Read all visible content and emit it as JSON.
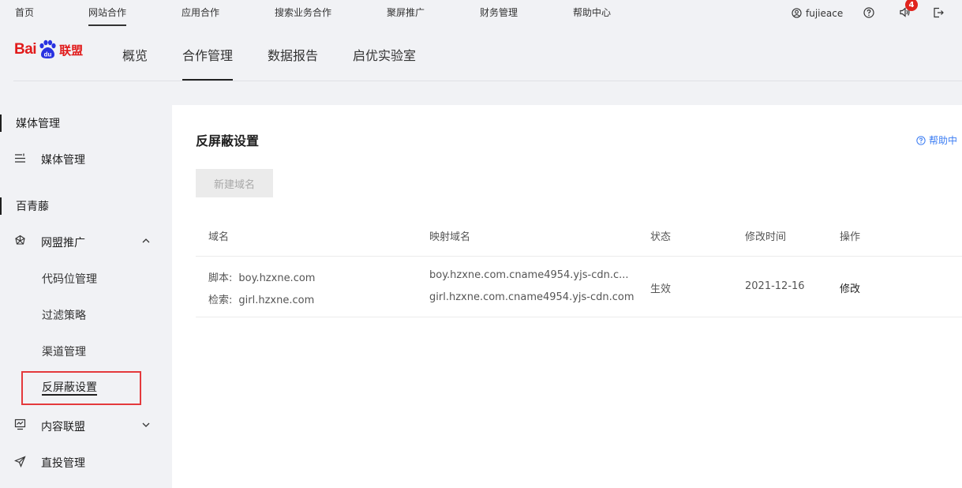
{
  "topnav": {
    "items": [
      "首页",
      "网站合作",
      "应用合作",
      "搜索业务合作",
      "聚屏推广",
      "财务管理",
      "帮助中心"
    ],
    "active_index": 1,
    "username": "fujieace",
    "notification_count": "4"
  },
  "header": {
    "logo": {
      "bai": "Bai",
      "du": "du",
      "lianmeng": "联盟"
    },
    "tabs": [
      "概览",
      "合作管理",
      "数据报告",
      "启优实验室"
    ],
    "active_tab_index": 1
  },
  "sidebar": {
    "group1": "媒体管理",
    "item_media": "媒体管理",
    "group2": "百青藤",
    "item_wangmeng": "网盟推广",
    "sub_items": [
      "代码位管理",
      "过滤策略",
      "渠道管理",
      "反屏蔽设置"
    ],
    "selected_sub_index": 3,
    "item_content": "内容联盟",
    "item_direct": "直投管理"
  },
  "main": {
    "title": "反屏蔽设置",
    "help_link": "帮助中",
    "new_domain_button": "新建域名",
    "table": {
      "headers": [
        "域名",
        "映射域名",
        "状态",
        "修改时间",
        "操作"
      ],
      "rows": [
        {
          "domain_script_label": "脚本:",
          "domain_script": "boy.hzxne.com",
          "domain_search_label": "检索:",
          "domain_search": "girl.hzxne.com",
          "mapped_script": "boy.hzxne.com.cname4954.yjs-cdn.c...",
          "mapped_search": "girl.hzxne.com.cname4954.yjs-cdn.com",
          "status": "生效",
          "modified": "2021-12-16",
          "action": "修改"
        }
      ]
    }
  },
  "colors": {
    "brand_red": "#e11a1a",
    "brand_blue": "#2932e1",
    "link_blue": "#3a7cf3",
    "highlight_box": "#e4393c"
  }
}
